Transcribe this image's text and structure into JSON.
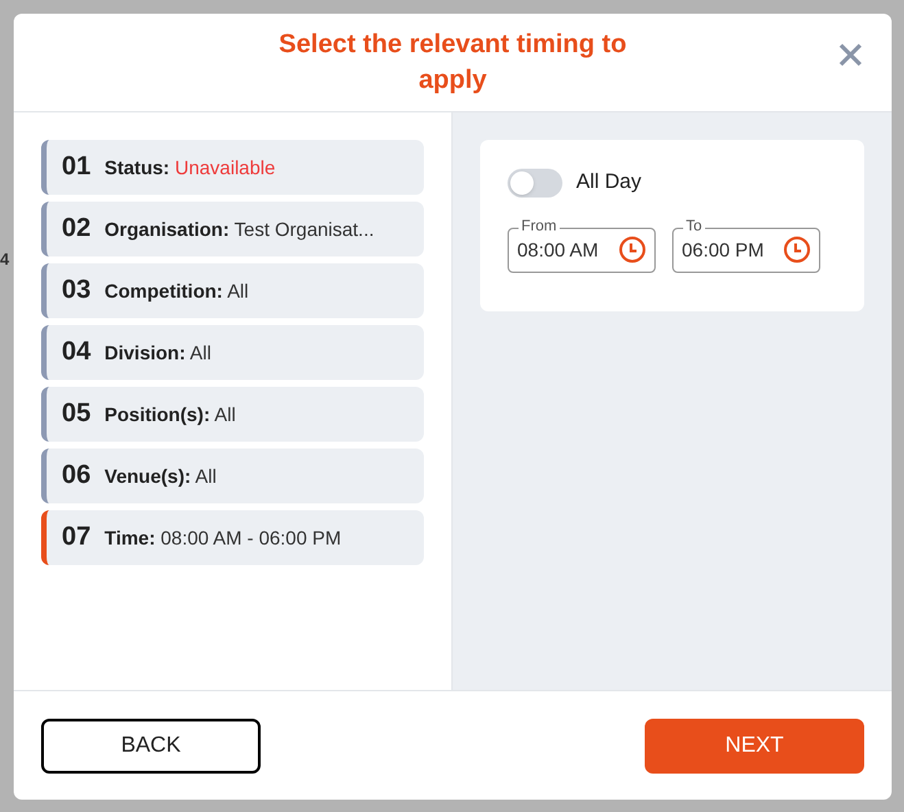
{
  "background": {
    "days": [
      "4"
    ]
  },
  "dialog": {
    "title": "Select the relevant timing to apply"
  },
  "steps": [
    {
      "number": "01",
      "label": "Status:",
      "value": "Unavailable",
      "alert": true,
      "selected": false
    },
    {
      "number": "02",
      "label": "Organisation:",
      "value": "Test Organisat...",
      "alert": false,
      "selected": false
    },
    {
      "number": "03",
      "label": "Competition:",
      "value": "All",
      "alert": false,
      "selected": false
    },
    {
      "number": "04",
      "label": "Division:",
      "value": "All",
      "alert": false,
      "selected": false
    },
    {
      "number": "05",
      "label": "Position(s):",
      "value": "All",
      "alert": false,
      "selected": false
    },
    {
      "number": "06",
      "label": "Venue(s):",
      "value": "All",
      "alert": false,
      "selected": false
    },
    {
      "number": "07",
      "label": "Time:",
      "value": "08:00 AM - 06:00 PM",
      "alert": false,
      "selected": true
    }
  ],
  "all_day": {
    "label": "All Day",
    "on": false
  },
  "times": [
    {
      "label": "From",
      "value": "08:00 AM"
    },
    {
      "label": "To",
      "value": "06:00 PM"
    }
  ],
  "buttons": {
    "back": "BACK",
    "next": "NEXT"
  }
}
